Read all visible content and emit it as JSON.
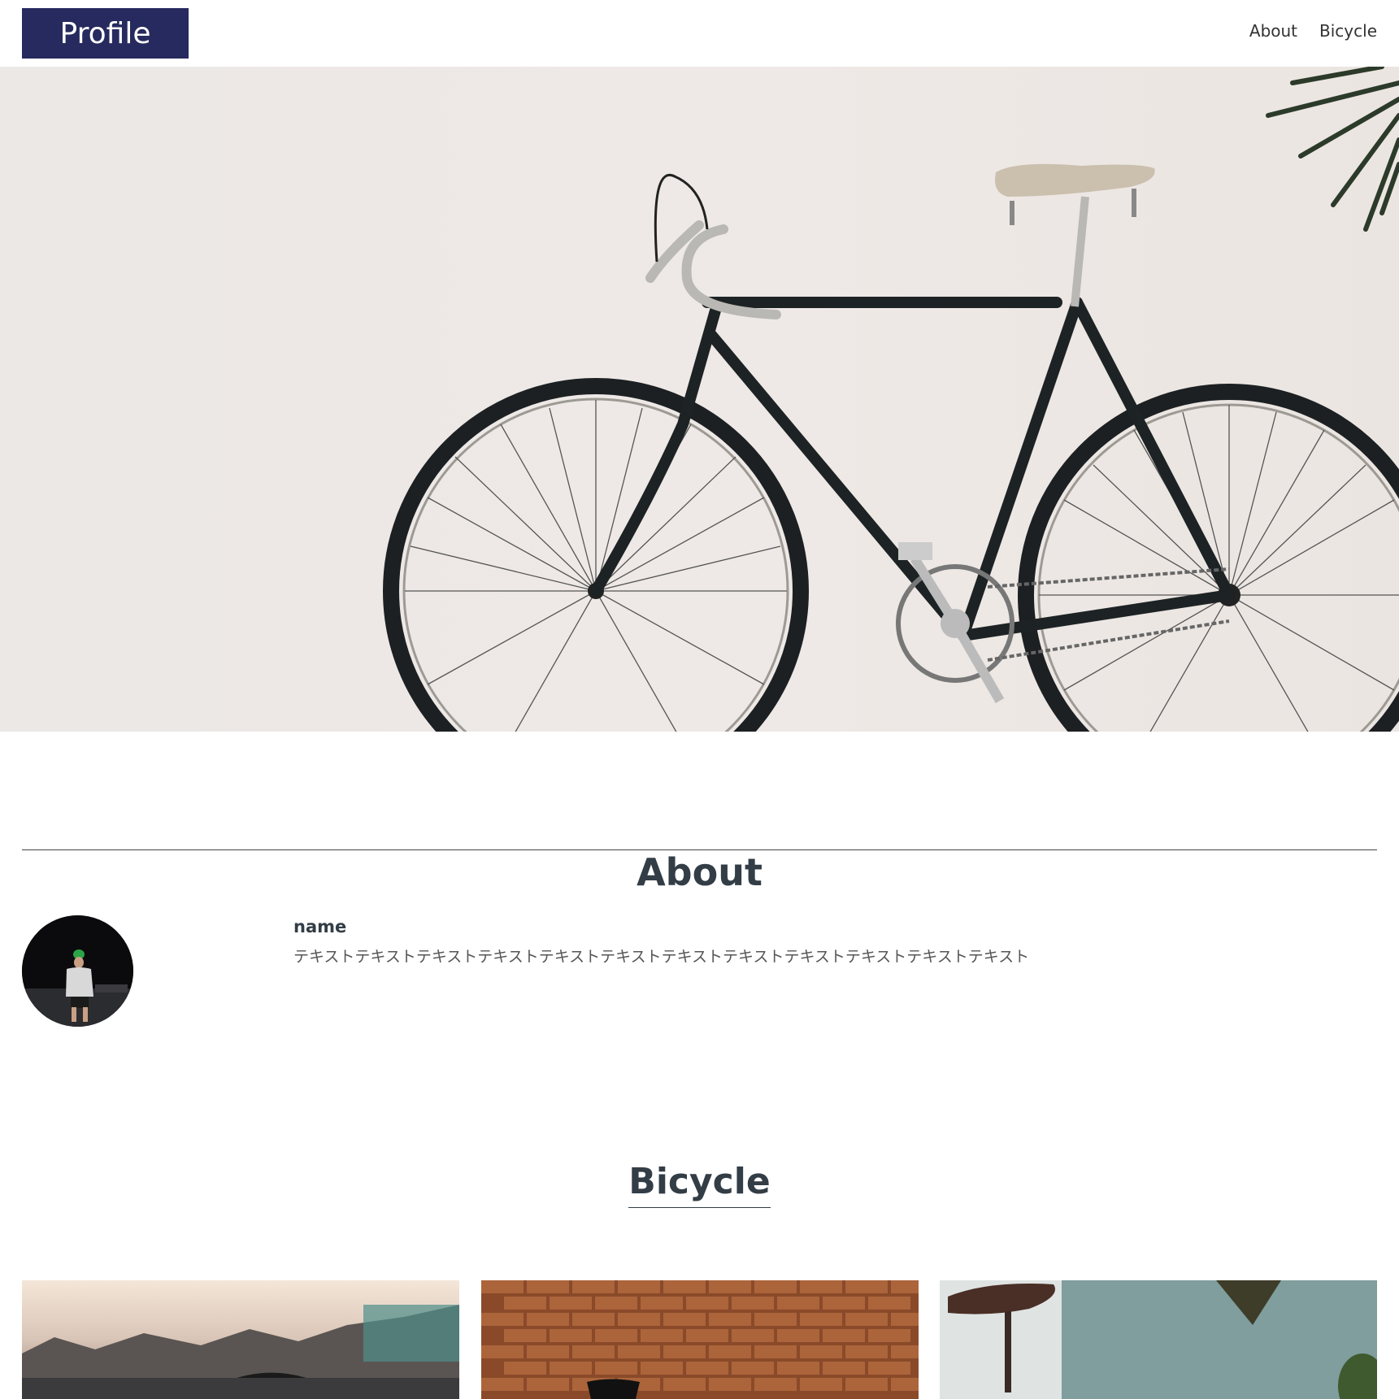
{
  "header": {
    "logo": "Profile",
    "nav": [
      "About",
      "Bicycle"
    ]
  },
  "hero": {
    "image": "bicycle-leaning-on-wall-photo"
  },
  "about": {
    "title": "About",
    "name": "name",
    "text": "テキストテキストテキストテキストテキストテキストテキストテキストテキストテキストテキストテキスト",
    "avatar": "person-in-green-cap-photo"
  },
  "bicycle": {
    "title": "Bicycle",
    "gallery": [
      "bicycle-saddle-street-photo",
      "bicycle-brick-wall-photo",
      "bicycle-saddle-wall-photo"
    ]
  },
  "colors": {
    "brand": "#262a5e",
    "heading": "#333d46",
    "text": "#555555"
  }
}
